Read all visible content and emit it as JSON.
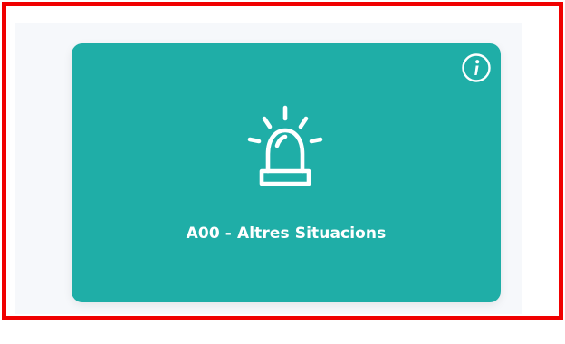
{
  "card": {
    "label": "A00 - Altres Situacions",
    "icon": "siren-icon",
    "info_icon": "info-icon",
    "background_color": "#1faea7"
  },
  "highlight": {
    "border_color": "#f00000"
  },
  "panel": {
    "background_color": "#f6f8fb"
  }
}
